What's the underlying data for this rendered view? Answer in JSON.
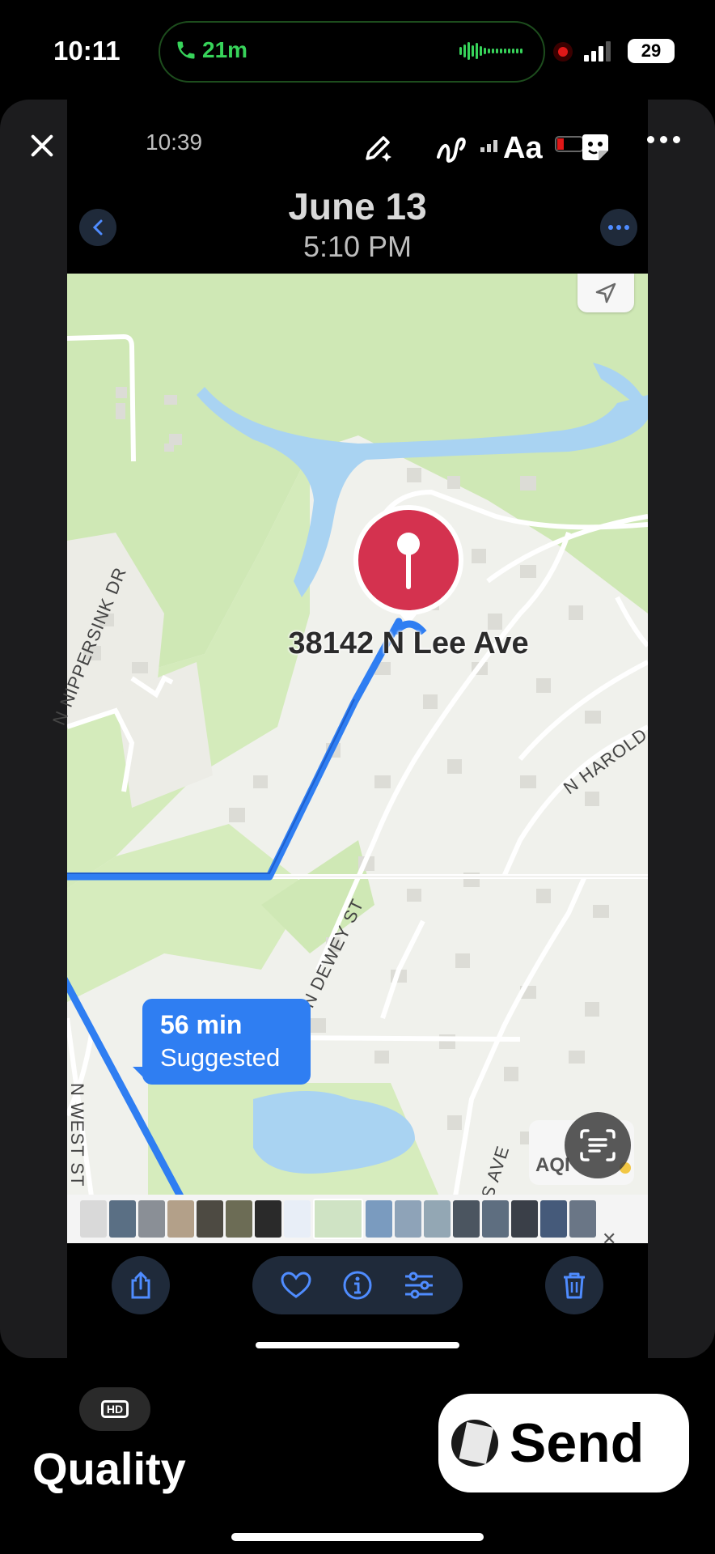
{
  "status_bar": {
    "time": "10:11",
    "call_duration": "21m",
    "battery": "29",
    "call_color": "#37d35a"
  },
  "story_editor": {
    "close_icon": "close-icon",
    "tools": [
      "pen-sparkle-icon",
      "squiggle-draw-icon",
      "text-tool-icon",
      "sticker-icon",
      "more-icon"
    ],
    "text_tool_label": "Aa"
  },
  "screenshot_inner": {
    "time": "10:39",
    "header": {
      "date": "June 13",
      "time": "5:10 PM"
    },
    "map": {
      "pin_label": "38142 N Lee Ave",
      "streets": [
        "N NIPPERSINK DR",
        "N HAROLD",
        "N DEWEY ST",
        "N WEST ST",
        "S AVE"
      ],
      "route": {
        "duration": "56 min",
        "type": "Suggested",
        "color": "#2f7ef2"
      },
      "aqi_label": "AQI",
      "pin_color": "#d4324f"
    },
    "toolbar": [
      "share-icon",
      "heart-icon",
      "info-icon",
      "adjust-icon",
      "trash-icon"
    ]
  },
  "bottom": {
    "hd_label": "HD",
    "quality_label": "Quality",
    "send_label": "Send"
  }
}
